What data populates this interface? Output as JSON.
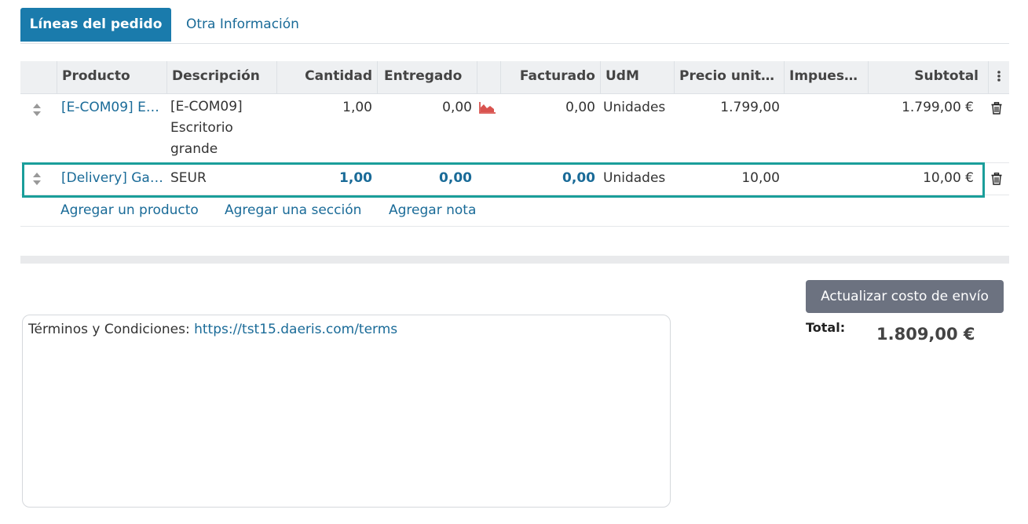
{
  "tabs": {
    "active": "Líneas del pedido",
    "other": "Otra Información"
  },
  "table": {
    "headers": [
      "Producto",
      "Descripción",
      "Cantidad",
      "Entregado",
      "Facturado",
      "UdM",
      "Precio unitar…",
      "Impuest…",
      "Subtotal"
    ],
    "menu_icon": "vertical-ellipsis-icon",
    "rows": [
      {
        "product": "[E-COM09] E…",
        "description": [
          "[E-COM09]",
          "Escritorio",
          "grande"
        ],
        "quantity": "1,00",
        "delivered": "0,00",
        "invoiced": "0,00",
        "uom": "Unidades",
        "unit_price": "1.799,00",
        "taxes": "",
        "subtotal": "1.799,00 €",
        "forecast_icon": "area-chart-icon",
        "forecast_color": "#d9534f"
      },
      {
        "product": "[Delivery] Ga…",
        "description": [
          "SEUR"
        ],
        "quantity": "1,00",
        "delivered": "0,00",
        "invoiced": "0,00",
        "uom": "Unidades",
        "unit_price": "10,00",
        "taxes": "",
        "subtotal": "10,00 €",
        "highlighted": true
      }
    ],
    "add_links": [
      "Agregar un producto",
      "Agregar una sección",
      "Agregar nota"
    ]
  },
  "footer": {
    "update_shipping_button": "Actualizar costo de envío",
    "total_label": "Total:",
    "total_value": "1.809,00 €",
    "terms_label": "Términos y Condiciones: ",
    "terms_link": "https://tst15.daeris.com/terms"
  },
  "colors": {
    "primary": "#1a7bac",
    "link": "#1a6b98",
    "highlight_outline": "#1a9e9a",
    "button_secondary": "#6c7280",
    "danger": "#d9534f"
  }
}
